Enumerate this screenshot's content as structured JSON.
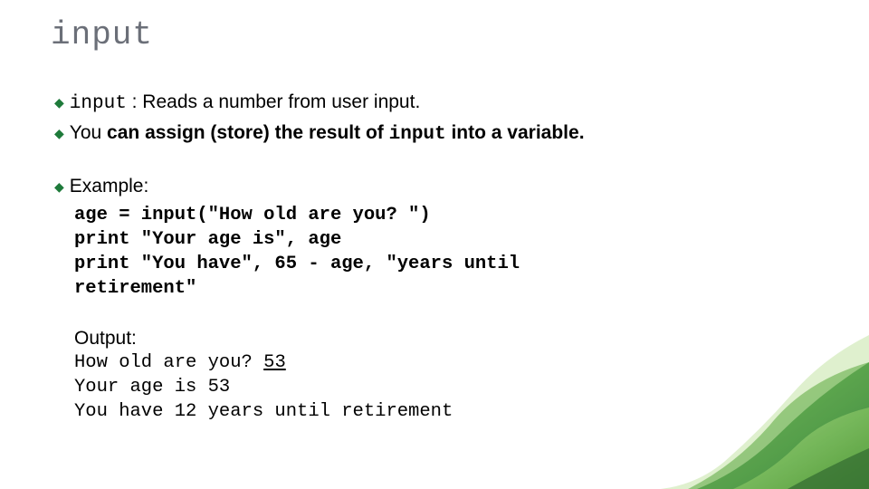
{
  "title": "input",
  "bullets": {
    "b1_code": "input",
    "b1_rest": " : Reads a number from user input.",
    "b2_pre": "You",
    "b2_bold_a": " can assign (store) the result of ",
    "b2_code": "input",
    "b2_bold_b": " into a variable.",
    "b3": "Example:"
  },
  "code": {
    "l1": "age = input(\"How old are you? \")",
    "l2": "print \"Your age is\", age",
    "l3": "print \"You have\", 65 - age, \"years until",
    "l4": "retirement\""
  },
  "output": {
    "label": "Output:",
    "l1a": "How old are you? ",
    "l1b": "53",
    "l2": "Your age is 53",
    "l3": "You have 12 years until retirement"
  }
}
